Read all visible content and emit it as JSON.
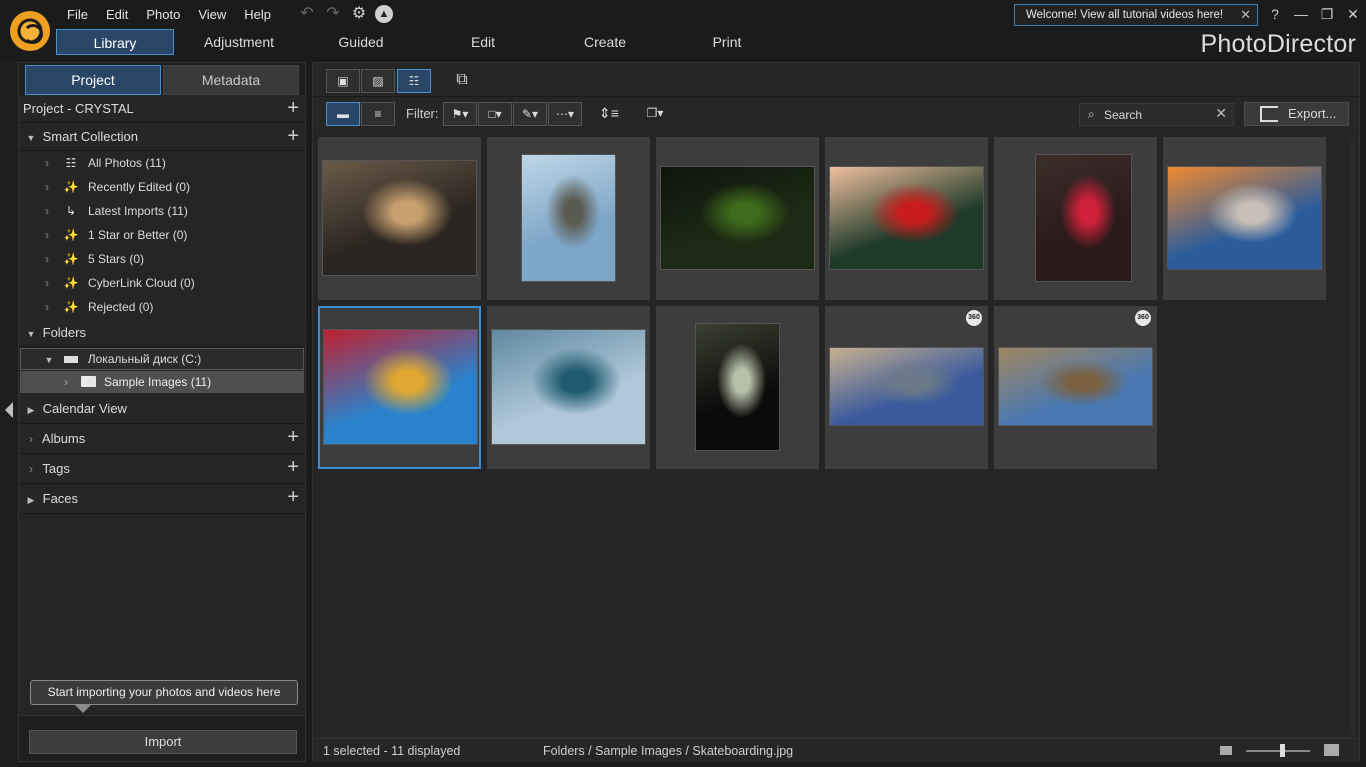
{
  "app": {
    "brand": "PhotoDirector",
    "menu": [
      "File",
      "Edit",
      "Photo",
      "View",
      "Help"
    ],
    "welcome_text": "Welcome! View all tutorial videos here!",
    "help_icon": "?",
    "accent": "#4a8fd0",
    "selected_bg": "#2a4666"
  },
  "mode_tabs": [
    "Library",
    "Adjustment",
    "Guided",
    "Edit",
    "Create",
    "Print"
  ],
  "active_mode": "Library",
  "left_panel": {
    "tabs": [
      "Project",
      "Metadata"
    ],
    "project_label": "Project - CRYSTAL",
    "smart_collection": {
      "label": "Smart Collection",
      "items": [
        {
          "label": "All Photos (11)",
          "icon": "all-photos-icon"
        },
        {
          "label": "Recently Edited (0)",
          "icon": "magic-wand-icon"
        },
        {
          "label": "Latest Imports (11)",
          "icon": "import-arrow-icon"
        },
        {
          "label": "1 Star or Better (0)",
          "icon": "magic-wand-icon"
        },
        {
          "label": "5 Stars (0)",
          "icon": "magic-wand-icon"
        },
        {
          "label": "CyberLink Cloud (0)",
          "icon": "magic-wand-icon"
        },
        {
          "label": "Rejected (0)",
          "icon": "magic-wand-icon"
        }
      ]
    },
    "folders": {
      "label": "Folders",
      "drive": "Локальный диск (C:)",
      "subfolder": "Sample Images (11)"
    },
    "calendar_view": "Calendar View",
    "albums": "Albums",
    "tags": "Tags",
    "faces": "Faces",
    "import_tip": "Start importing your photos and videos here",
    "import_button": "Import"
  },
  "toolbar": {
    "filter_label": "Filter:",
    "search_placeholder": "Search",
    "export_label": "Export..."
  },
  "thumbnails": [
    {
      "name": "basketball-dunk",
      "selected": false,
      "is360": false,
      "colors": [
        "#2a2520",
        "#c8a070",
        "#6b5a48"
      ]
    },
    {
      "name": "rock-island-boat",
      "selected": false,
      "is360": false,
      "colors": [
        "#7ea6c8",
        "#5b5a52",
        "#bfd6e6"
      ]
    },
    {
      "name": "forest",
      "selected": false,
      "is360": false,
      "colors": [
        "#1d2a14",
        "#3e6b1c",
        "#0e140b"
      ]
    },
    {
      "name": "red-maple-leaf",
      "selected": false,
      "is360": false,
      "colors": [
        "#1e3a28",
        "#c81c1c",
        "#f0c0a0"
      ]
    },
    {
      "name": "neon-storefront",
      "selected": false,
      "is360": false,
      "colors": [
        "#2a1a1a",
        "#d0203a",
        "#3a2e2a"
      ]
    },
    {
      "name": "rocket-launch",
      "selected": false,
      "is360": false,
      "colors": [
        "#2a5c9c",
        "#c8c0b8",
        "#f08a30"
      ]
    },
    {
      "name": "skateboarder",
      "selected": true,
      "is360": false,
      "colors": [
        "#2a82cc",
        "#e0a830",
        "#c02030"
      ]
    },
    {
      "name": "ocean-wave",
      "selected": false,
      "is360": false,
      "colors": [
        "#b0c8d8",
        "#1e5a70",
        "#5f8aa0"
      ]
    },
    {
      "name": "window-light",
      "selected": false,
      "is360": false,
      "colors": [
        "#0b0b0b",
        "#b8c0a8",
        "#3a4030"
      ]
    },
    {
      "name": "panorama-plaza",
      "selected": false,
      "is360": true,
      "colors": [
        "#3a5a9c",
        "#6b7a88",
        "#c8b090"
      ]
    },
    {
      "name": "panorama-mountain",
      "selected": false,
      "is360": true,
      "colors": [
        "#4a78b0",
        "#7a6040",
        "#a08660"
      ]
    }
  ],
  "badge_360": "360",
  "status": {
    "selection": "1 selected - 11 displayed",
    "path": "Folders / Sample Images / Skateboarding.jpg"
  }
}
